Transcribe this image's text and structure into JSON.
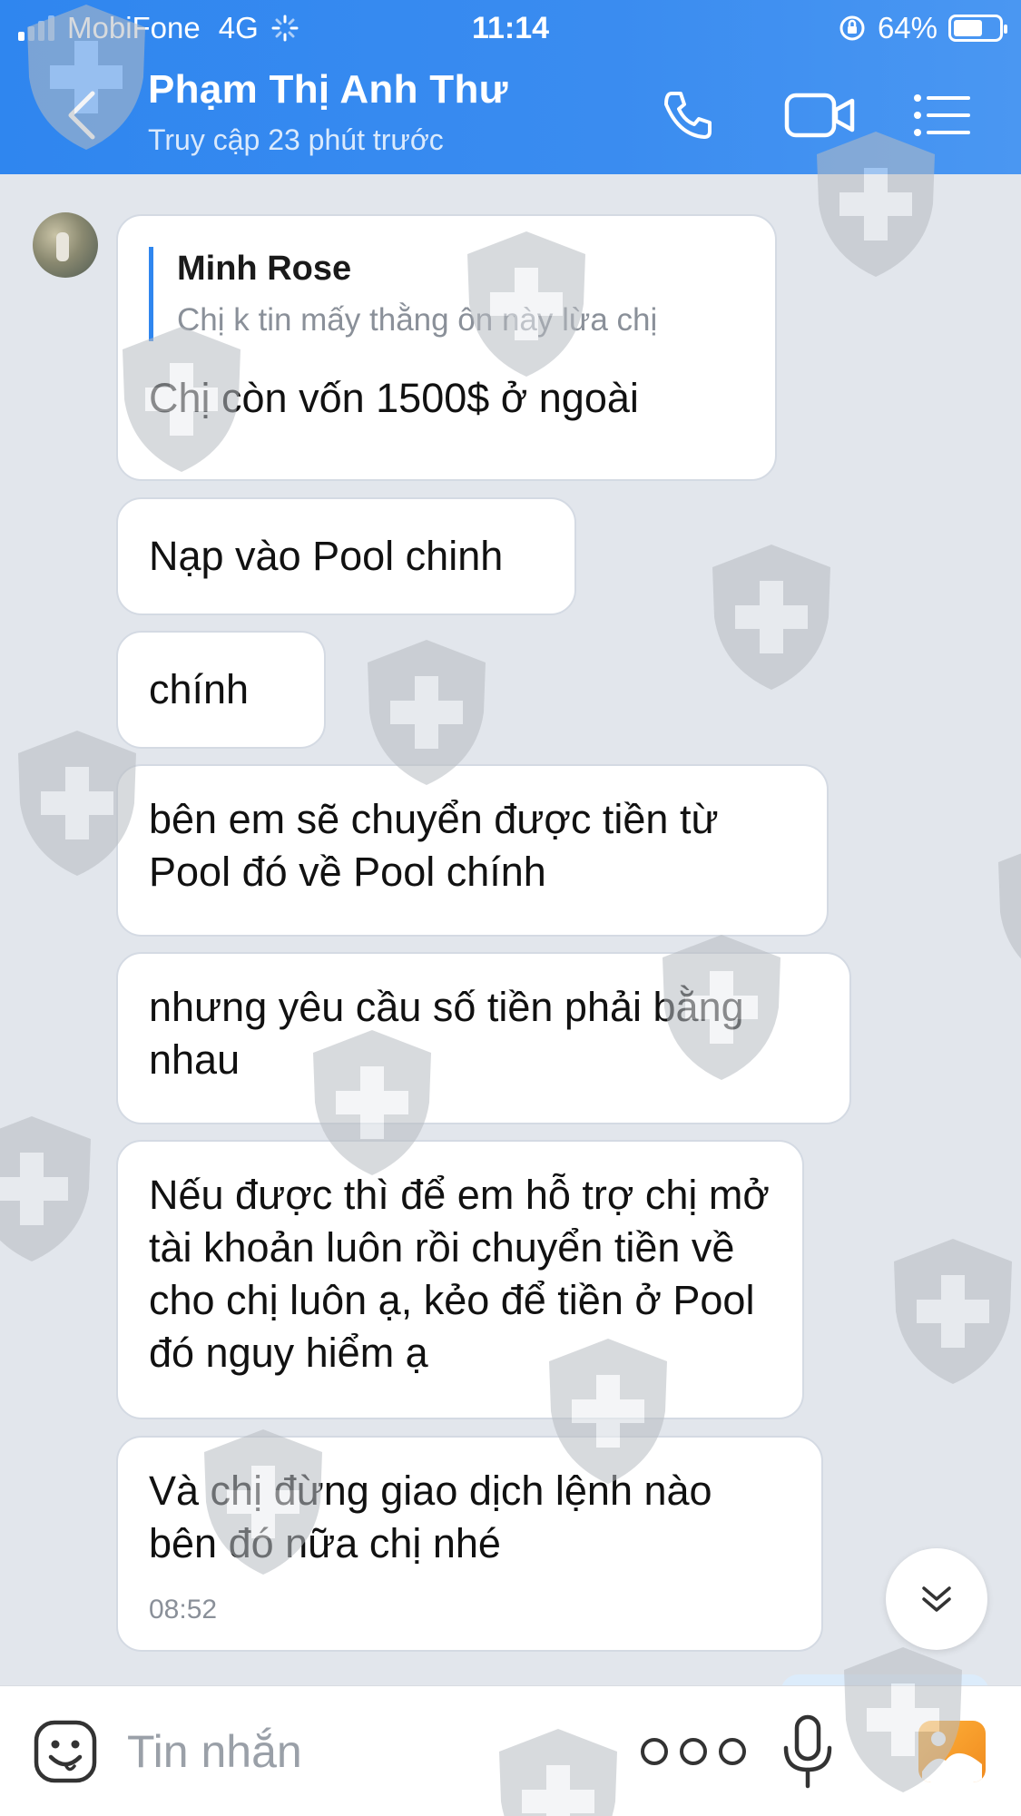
{
  "status_bar": {
    "carrier": "MobiFone",
    "network": "4G",
    "time": "11:14",
    "battery": "64%",
    "battery_fraction": 0.64
  },
  "header": {
    "contact_name": "Phạm Thị Anh Thư",
    "contact_status": "Truy cập 23 phút trước",
    "icons": [
      "back-icon",
      "phone-icon",
      "video-call-icon",
      "menu-icon"
    ]
  },
  "messages": [
    {
      "quote_author": "Minh Rose",
      "quote_text": "Chị k tin mấy thằng ôn này lừa chị",
      "text": "Chị còn vốn 1500$ ở ngoài"
    },
    {
      "text": "Nạp vào Pool chinh"
    },
    {
      "text": "chính"
    },
    {
      "text": "bên em sẽ chuyển được tiền từ Pool đó về Pool chính"
    },
    {
      "text": "nhưng yêu cầu số tiền phải bằng nhau"
    },
    {
      "text": "Nếu được thì để em hỗ trợ chị mở tài khoản luôn rồi chuyển tiền về cho chị luôn ạ, kẻo để tiền ở Pool đó nguy hiểm ạ"
    },
    {
      "text": "Và chị đừng giao dịch lệnh nào bên đó nữa chị nhé",
      "time": "08:52"
    }
  ],
  "input": {
    "placeholder": "Tin nhắn",
    "icons": [
      "emoji-icon",
      "more-icon",
      "microphone-icon",
      "image-icon"
    ]
  },
  "colors": {
    "header": "#2f86ef",
    "accent": "#2f86ef",
    "chat_background": "#e2e6ec",
    "bubble_incoming": "#ffffff",
    "bubble_outgoing": "#dcecfb"
  }
}
